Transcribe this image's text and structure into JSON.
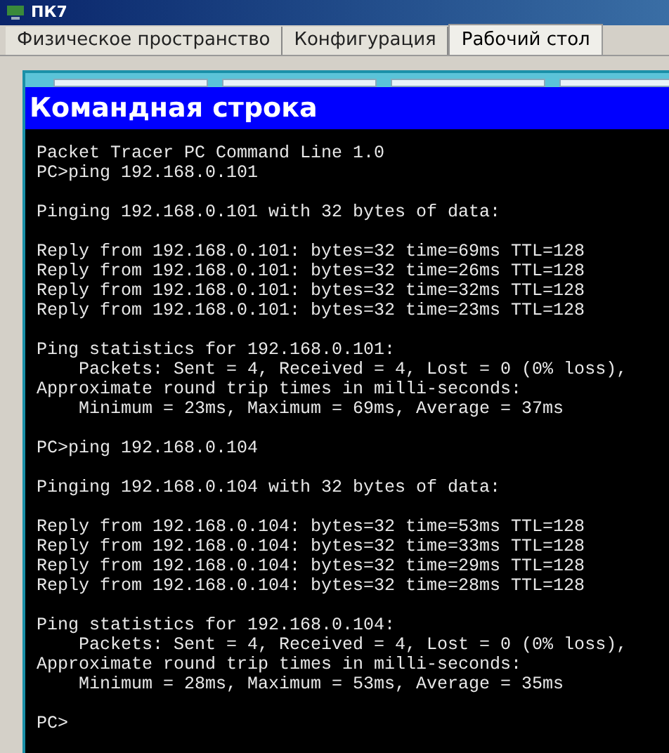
{
  "window": {
    "title": "ПК7"
  },
  "tabs": [
    {
      "label": "Физическое пространство",
      "selected": false
    },
    {
      "label": "Конфигурация",
      "selected": false
    },
    {
      "label": "Рабочий стол",
      "selected": true
    }
  ],
  "panel": {
    "title": "Командная строка"
  },
  "terminal": {
    "blocks": [
      [
        "Packet Tracer PC Command Line 1.0",
        "PC>ping 192.168.0.101"
      ],
      [
        "Pinging 192.168.0.101 with 32 bytes of data:"
      ],
      [
        "Reply from 192.168.0.101: bytes=32 time=69ms TTL=128",
        "Reply from 192.168.0.101: bytes=32 time=26ms TTL=128",
        "Reply from 192.168.0.101: bytes=32 time=32ms TTL=128",
        "Reply from 192.168.0.101: bytes=32 time=23ms TTL=128"
      ],
      [
        "Ping statistics for 192.168.0.101:",
        "    Packets: Sent = 4, Received = 4, Lost = 0 (0% loss),",
        "Approximate round trip times in milli-seconds:",
        "    Minimum = 23ms, Maximum = 69ms, Average = 37ms"
      ],
      [
        "PC>ping 192.168.0.104"
      ],
      [
        "Pinging 192.168.0.104 with 32 bytes of data:"
      ],
      [
        "Reply from 192.168.0.104: bytes=32 time=53ms TTL=128",
        "Reply from 192.168.0.104: bytes=32 time=33ms TTL=128",
        "Reply from 192.168.0.104: bytes=32 time=29ms TTL=128",
        "Reply from 192.168.0.104: bytes=32 time=28ms TTL=128"
      ],
      [
        "Ping statistics for 192.168.0.104:",
        "    Packets: Sent = 4, Received = 4, Lost = 0 (0% loss),",
        "Approximate round trip times in milli-seconds:",
        "    Minimum = 28ms, Maximum = 53ms, Average = 35ms"
      ],
      [
        "PC>"
      ]
    ]
  }
}
